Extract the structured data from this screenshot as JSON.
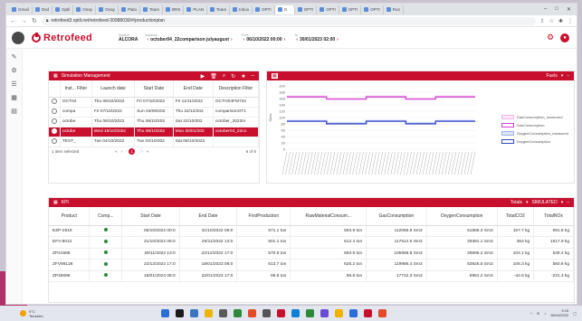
{
  "browser": {
    "tabs": [
      {
        "label": "Gmail"
      },
      {
        "label": "Dnd"
      },
      {
        "label": "Optil"
      },
      {
        "label": "Onay"
      },
      {
        "label": "Onay"
      },
      {
        "label": "Plato"
      },
      {
        "label": "Team"
      },
      {
        "label": "BRS"
      },
      {
        "label": "PLAN"
      },
      {
        "label": "Team"
      },
      {
        "label": "Inbox"
      },
      {
        "label": "OPTI"
      },
      {
        "label": "O",
        "active": true
      },
      {
        "label": "OPTI"
      },
      {
        "label": "OPTI"
      },
      {
        "label": "OPTI"
      },
      {
        "label": "OPTI"
      },
      {
        "label": "Run"
      }
    ],
    "url": "retrofeed3.optil.net/retrofeed-30988030/#/productionplan"
  },
  "header": {
    "logo_text": "Retrofeed",
    "system_label": "System",
    "system_value": "ALCORA",
    "instance_label": "Instance",
    "instance_value": "october04_22comparison julyaugust",
    "from_label": "From",
    "from_value": "06/10/2022 00:00",
    "to_label": "To",
    "to_value": "30/01/2023 02:00"
  },
  "sim": {
    "title": "Simulation Management",
    "columns": [
      "",
      "Inst... Filter",
      "Launch date",
      "Start Date",
      "End Date",
      "Description Filter"
    ],
    "rows": [
      {
        "inst": "OCT04",
        "launch": "Thu 06/10/2022",
        "start": "Fri 07/10/2022",
        "end": "Fri 11/11/2022",
        "desc": "OCTO04FM734",
        "selected": false
      },
      {
        "inst": "compa",
        "launch": "Fri 07/10/2022",
        "start": "Sun 04/09/202",
        "end": "Thu 22/12/202",
        "desc": "comparisonOT1",
        "selected": false
      },
      {
        "inst": "octobe",
        "launch": "Thu 06/10/2022",
        "start": "Thu 06/10/202",
        "end": "Sat 22/10/202",
        "desc": "october_2022m",
        "selected": false
      },
      {
        "inst": "octobe",
        "launch": "Wed 19/10/2022",
        "start": "Thu 06/10/202",
        "end": "Mon 30/01/202",
        "desc": "october04_22co",
        "selected": true
      },
      {
        "inst": "TEST_",
        "launch": "Tue 04/10/2022",
        "start": "Tue 04/10/202",
        "end": "Sat 08/10/2022",
        "desc": "",
        "selected": false
      }
    ],
    "footer_left": "1 item selected",
    "page": "1",
    "footer_right": "6 of 6"
  },
  "chart_panel": {
    "dropdown": "Fuels"
  },
  "chart_data": {
    "type": "line",
    "ylabel": "Sims",
    "ylim": [
      0,
      200
    ],
    "yticks": [
      0,
      20,
      40,
      60,
      80,
      100,
      120,
      140,
      160,
      180,
      200
    ],
    "series": [
      {
        "name": "GasConsumption_measured",
        "color": "#f0b8e6",
        "values": [
          167,
          167,
          167,
          167,
          160,
          160,
          160,
          160,
          167,
          167,
          167,
          167,
          160,
          160,
          160,
          167,
          167,
          167,
          167,
          167
        ]
      },
      {
        "name": "GasConsumption",
        "color": "#d43fd6",
        "values": [
          165,
          165,
          165,
          165,
          158,
          158,
          158,
          158,
          165,
          165,
          165,
          165,
          158,
          158,
          158,
          165,
          165,
          165,
          165,
          165
        ]
      },
      {
        "name": "OxygenConsumption_measured",
        "color": "#9fb0ef",
        "values": [
          90,
          90,
          90,
          90,
          82,
          82,
          82,
          82,
          90,
          90,
          90,
          90,
          82,
          82,
          82,
          90,
          90,
          90,
          90,
          90
        ]
      },
      {
        "name": "OxygenConsumption",
        "color": "#3043c8",
        "values": [
          88,
          88,
          88,
          88,
          80,
          80,
          80,
          80,
          88,
          88,
          88,
          88,
          80,
          80,
          80,
          88,
          88,
          88,
          88,
          88
        ]
      }
    ],
    "grid": true,
    "legend_position": "right"
  },
  "kpi": {
    "title": "KPI",
    "totals_label": "Totals",
    "mode_label": "SIMULATED",
    "columns": [
      "Product",
      "Comp...",
      "Start Date",
      "End Date",
      "FirstProduction",
      "RawMaterialConsum...",
      "GasConsumption",
      "OxygenConsumption",
      "TotalCO2",
      "TotalNOx"
    ],
    "rows": [
      [
        "EZP-2519",
        "06/10/2022 00:0",
        "31/10/2022 06:0",
        "571.1 ton",
        "593.9 ton",
        "112056.8 Sm3",
        "51866.3 Sm3",
        "157.7 kg",
        "691.8 kg"
      ],
      [
        "EFV-8012",
        "31/10/2022 06:0",
        "26/11/2022 13:0",
        "601.1 ton",
        "612.4 ton",
        "117514.5 Sm3",
        "29381.1 Sm3",
        "364 kg",
        "1517.9 kg"
      ],
      [
        "ZP21598",
        "26/11/2022 13:0",
        "22/12/2022 17:0",
        "570.9 ton",
        "593.8 ton",
        "105958.8 Sm3",
        "29596.2 Sm3",
        "104.1 kg",
        "549.4 kg"
      ],
      [
        "ZFV98128",
        "22/12/2022 17:0",
        "18/01/2023 08:0",
        "613.7 ton",
        "625.2 ton",
        "119986.4 Sm3",
        "53926.5 Sm3",
        "106.3 kg",
        "560.8 kg"
      ],
      [
        "ZP25698",
        "18/01/2023 08:0",
        "22/01/2023 17:0",
        "95.8 ton",
        "98.8 ton",
        "17722.3 Sm3",
        "8981.2 Sm3",
        "-44.6 kg",
        "-231.3 kg"
      ]
    ]
  },
  "taskbar": {
    "temp": "9°C",
    "weather": "Temizlen",
    "time": "9:15",
    "date": "28/10/2022"
  }
}
